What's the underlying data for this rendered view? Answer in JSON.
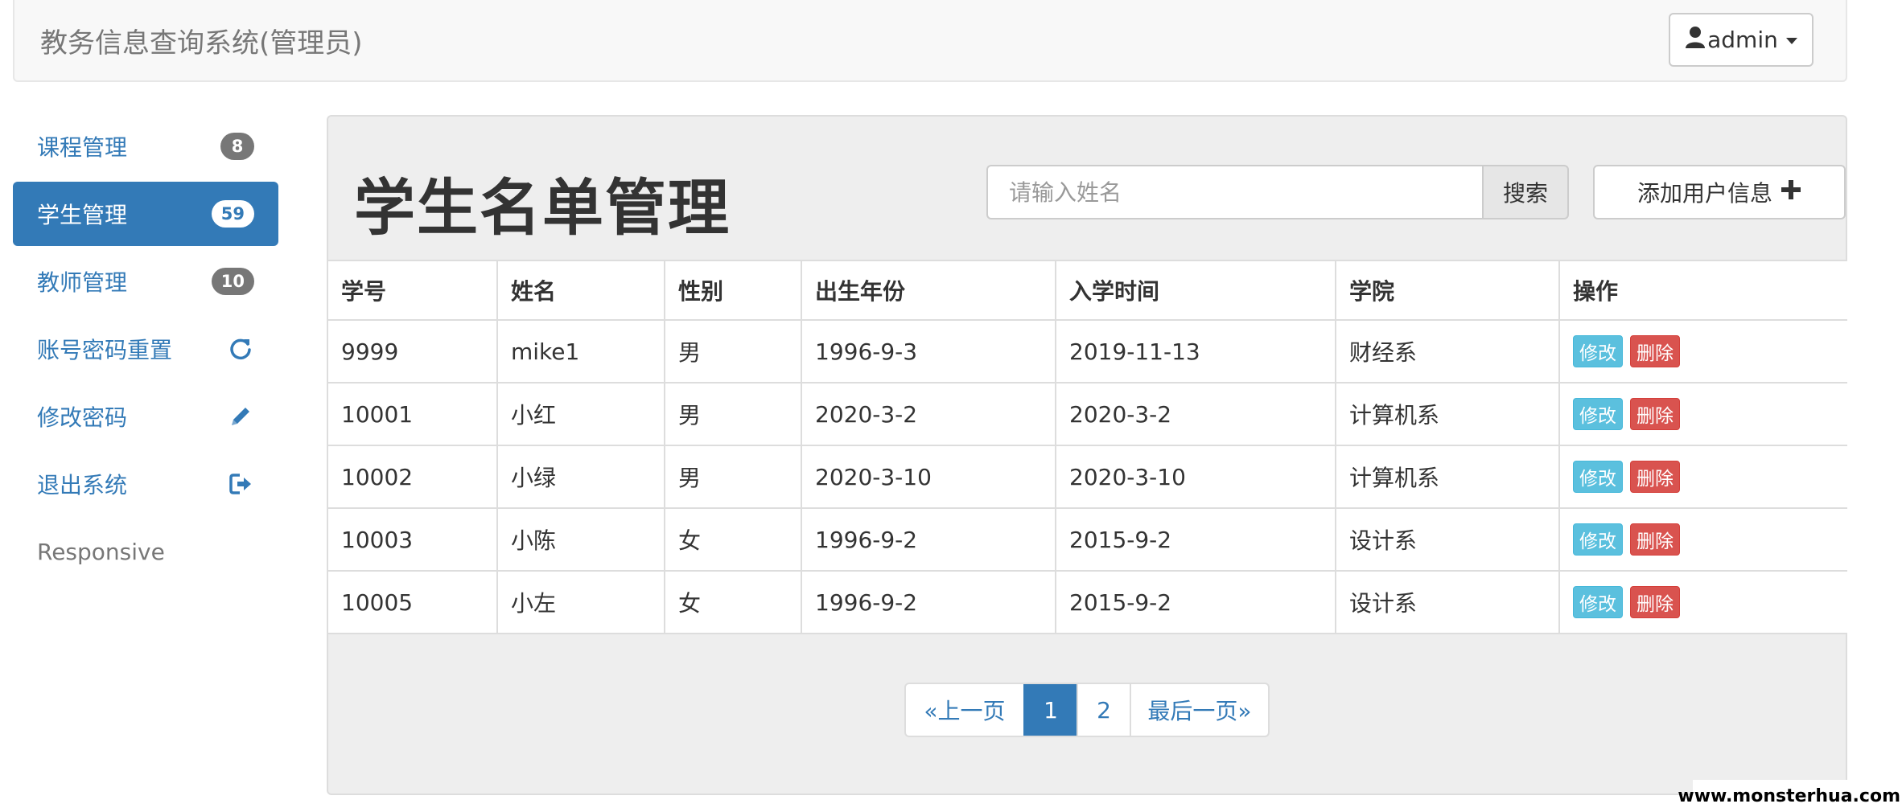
{
  "navbar": {
    "brand": "教务信息查询系统(管理员)",
    "user": "admin"
  },
  "sidebar": {
    "items": [
      {
        "label": "课程管理",
        "badge": "8"
      },
      {
        "label": "学生管理",
        "badge": "59"
      },
      {
        "label": "教师管理",
        "badge": "10"
      },
      {
        "label": "账号密码重置",
        "icon": "refresh-icon"
      },
      {
        "label": "修改密码",
        "icon": "pencil-icon"
      },
      {
        "label": "退出系统",
        "icon": "log-out-icon"
      },
      {
        "label": "Responsive"
      }
    ]
  },
  "main": {
    "title": "学生名单管理",
    "search": {
      "placeholder": "请输入姓名",
      "button": "搜索"
    },
    "add_button": "添加用户信息",
    "table": {
      "headers": [
        "学号",
        "姓名",
        "性别",
        "出生年份",
        "入学时间",
        "学院",
        "操作"
      ],
      "rows": [
        [
          "9999",
          "mike1",
          "男",
          "1996-9-3",
          "2019-11-13",
          "财经系"
        ],
        [
          "10001",
          "小红",
          "男",
          "2020-3-2",
          "2020-3-2",
          "计算机系"
        ],
        [
          "10002",
          "小绿",
          "男",
          "2020-3-10",
          "2020-3-10",
          "计算机系"
        ],
        [
          "10003",
          "小陈",
          "女",
          "1996-9-2",
          "2015-9-2",
          "设计系"
        ],
        [
          "10005",
          "小左",
          "女",
          "1996-9-2",
          "2015-9-2",
          "设计系"
        ]
      ],
      "edit_label": "修改",
      "delete_label": "删除"
    },
    "pagination": {
      "prev": "«上一页",
      "pages": [
        "1",
        "2"
      ],
      "current": "1",
      "last": "最后一页»"
    }
  },
  "watermark": "www.monsterhua.com",
  "colors": {
    "primary": "#337ab7",
    "info": "#5bc0de",
    "danger": "#d9534f",
    "badge": "#777777"
  }
}
